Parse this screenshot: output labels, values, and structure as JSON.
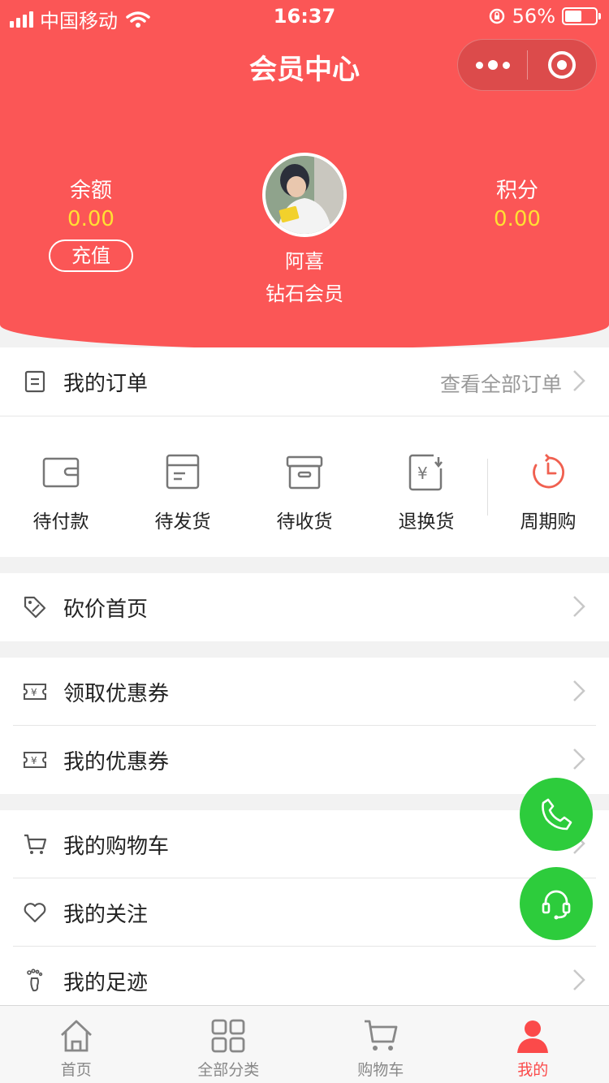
{
  "status_bar": {
    "carrier": "中国移动",
    "time": "16:37",
    "battery": "56%"
  },
  "header": {
    "title": "会员中心"
  },
  "balance": {
    "label": "余额",
    "value": "0.00",
    "recharge_label": "充值"
  },
  "points": {
    "label": "积分",
    "value": "0.00"
  },
  "user": {
    "name": "阿喜",
    "level": "钻石会员"
  },
  "orders": {
    "title": "我的订单",
    "view_all": "查看全部订单",
    "items": [
      {
        "label": "待付款",
        "icon": "wallet-icon"
      },
      {
        "label": "待发货",
        "icon": "package-icon"
      },
      {
        "label": "待收货",
        "icon": "box-icon"
      },
      {
        "label": "退换货",
        "icon": "refund-icon"
      },
      {
        "label": "周期购",
        "icon": "clock-cycle-icon"
      }
    ]
  },
  "menu": {
    "bargain": "砍价首页",
    "get_coupon": "领取优惠券",
    "my_coupon": "我的优惠券",
    "cart": "我的购物车",
    "follow": "我的关注",
    "footprint": "我的足迹"
  },
  "tabbar": [
    {
      "label": "首页",
      "icon": "home-icon"
    },
    {
      "label": "全部分类",
      "icon": "grid-icon"
    },
    {
      "label": "购物车",
      "icon": "cart-icon"
    },
    {
      "label": "我的",
      "icon": "user-icon",
      "active": true
    }
  ],
  "colors": {
    "primary": "#fb5656",
    "value_yellow": "#ffe033",
    "fab_green": "#2dcc3c",
    "active_tab": "#fb4a4a"
  }
}
